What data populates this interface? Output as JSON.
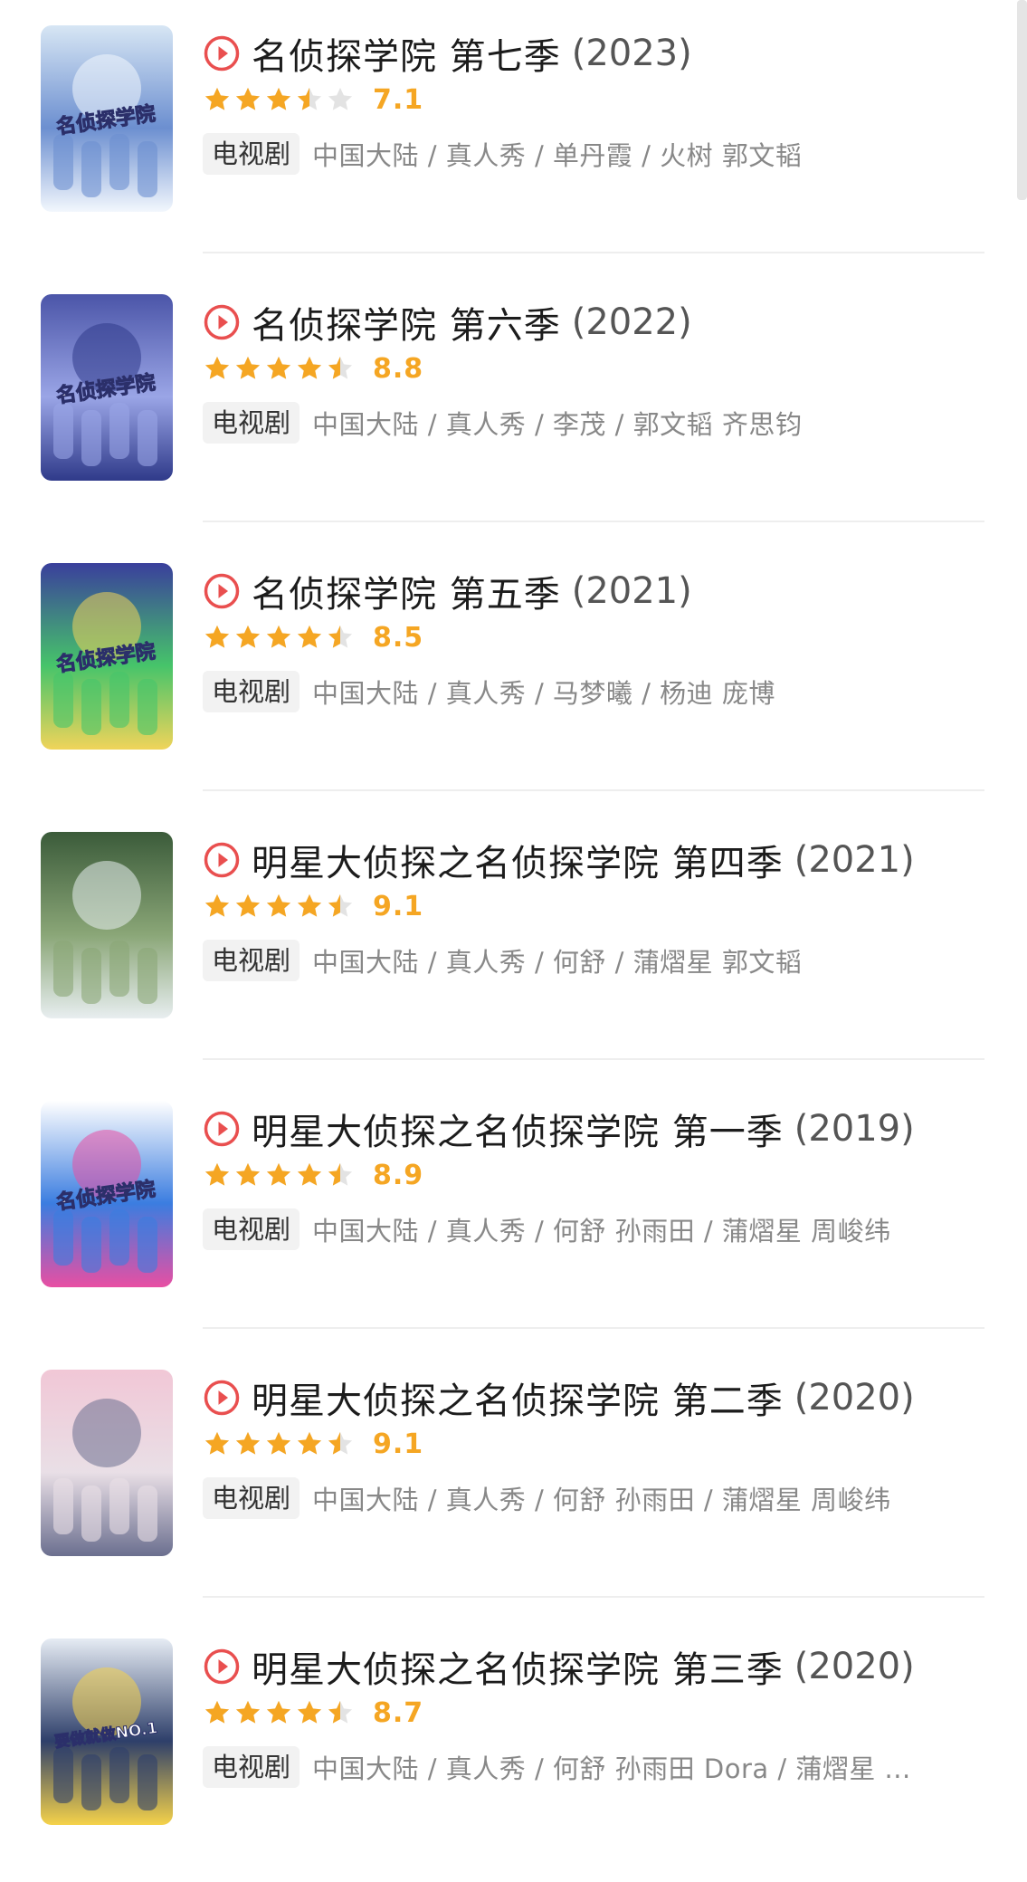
{
  "accent_color": "#e94f4f",
  "star_color": "#f5a623",
  "star_empty_color": "#e3e3e3",
  "items": [
    {
      "title": "名侦探学院 第七季",
      "year": "(2023)",
      "score": "7.1",
      "score_value": 7.1,
      "stars_shown": 3.5,
      "tag": "电视剧",
      "meta": "中国大陆 / 真人秀 / 单丹霞 / 火树 郭文韬",
      "poster_icon": "poster-season-7",
      "poster_colors": [
        "#d7e6f4",
        "#6c8fd0",
        "#f2f7fd"
      ],
      "poster_text": "名侦探学院"
    },
    {
      "title": "名侦探学院 第六季",
      "year": "(2022)",
      "score": "8.8",
      "score_value": 8.8,
      "stars_shown": 4.5,
      "tag": "电视剧",
      "meta": "中国大陆 / 真人秀 / 李茂 / 郭文韬 齐思钧",
      "poster_icon": "poster-season-6",
      "poster_colors": [
        "#4b55a8",
        "#9aa5e6",
        "#2f3a8a"
      ],
      "poster_text": "名侦探学院"
    },
    {
      "title": "名侦探学院 第五季",
      "year": "(2021)",
      "score": "8.5",
      "score_value": 8.5,
      "stars_shown": 4.5,
      "tag": "电视剧",
      "meta": "中国大陆 / 真人秀 / 马梦曦 / 杨迪 庞博",
      "poster_icon": "poster-season-5",
      "poster_colors": [
        "#3a3f9c",
        "#46c46a",
        "#f0d45a"
      ],
      "poster_text": "名侦探学院"
    },
    {
      "title": "明星大侦探之名侦探学院 第四季",
      "year": "(2021)",
      "score": "9.1",
      "score_value": 9.1,
      "stars_shown": 4.5,
      "tag": "电视剧",
      "meta": "中国大陆 / 真人秀 / 何舒 / 蒲熠星 郭文韬",
      "poster_icon": "poster-season-4",
      "poster_colors": [
        "#3b5b3a",
        "#8aa677",
        "#e8eef0"
      ],
      "poster_text": ""
    },
    {
      "title": "明星大侦探之名侦探学院 第一季",
      "year": "(2019)",
      "score": "8.9",
      "score_value": 8.9,
      "stars_shown": 4.5,
      "tag": "电视剧",
      "meta": "中国大陆 / 真人秀 / 何舒 孙雨田 / 蒲熠星 周峻纬",
      "poster_icon": "poster-season-1",
      "poster_colors": [
        "#ffffff",
        "#3b7de0",
        "#e84fa3"
      ],
      "poster_text": "名侦探学院"
    },
    {
      "title": "明星大侦探之名侦探学院 第二季",
      "year": "(2020)",
      "score": "9.1",
      "score_value": 9.1,
      "stars_shown": 4.5,
      "tag": "电视剧",
      "meta": "中国大陆 / 真人秀 / 何舒 孙雨田 / 蒲熠星 周峻纬",
      "poster_icon": "poster-season-2",
      "poster_colors": [
        "#f1c7d6",
        "#e9dfe6",
        "#6b6f8f"
      ],
      "poster_text": ""
    },
    {
      "title": "明星大侦探之名侦探学院 第三季",
      "year": "(2020)",
      "score": "8.7",
      "score_value": 8.7,
      "stars_shown": 4.5,
      "tag": "电视剧",
      "meta": "中国大陆 / 真人秀 / 何舒 孙雨田 Dora / 蒲熠星 ...",
      "poster_icon": "poster-season-3",
      "poster_colors": [
        "#e6ecf4",
        "#2e3f6a",
        "#f5d24a"
      ],
      "poster_text": "要做就做NO.1"
    }
  ]
}
